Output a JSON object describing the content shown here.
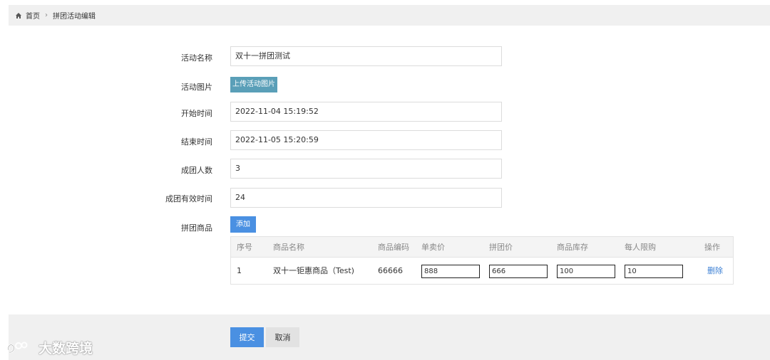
{
  "breadcrumb": {
    "home": "首页",
    "separator": "›",
    "current": "拼团活动编辑"
  },
  "form": {
    "activity_name": {
      "label": "活动名称",
      "value": "双十一拼团测试"
    },
    "activity_image": {
      "label": "活动图片",
      "button": "上传活动图片"
    },
    "start_time": {
      "label": "开始时间",
      "value": "2022-11-04 15:19:52"
    },
    "end_time": {
      "label": "结束时间",
      "value": "2022-11-05 15:20:59"
    },
    "group_size": {
      "label": "成团人数",
      "value": "3"
    },
    "valid_time": {
      "label": "成团有效时间",
      "value": "24"
    },
    "products": {
      "label": "拼团商品",
      "add_button": "添加"
    }
  },
  "table": {
    "headers": [
      "序号",
      "商品名称",
      "商品编码",
      "单卖价",
      "拼团价",
      "商品库存",
      "每人限购",
      "操作"
    ],
    "rows": [
      {
        "index": "1",
        "name": "双十一钜惠商品（Test)",
        "code": "66666",
        "single_price": "888",
        "group_price": "666",
        "stock": "100",
        "limit": "10",
        "action": "删除"
      }
    ]
  },
  "footer": {
    "submit": "提交",
    "cancel": "取消"
  },
  "watermark": {
    "text": "大数跨境"
  },
  "colors": {
    "primary": "#4a90e2",
    "upload": "#5a9fb8",
    "link": "#3b7fd4",
    "breadcrumb_bg": "#f0f0f0"
  }
}
